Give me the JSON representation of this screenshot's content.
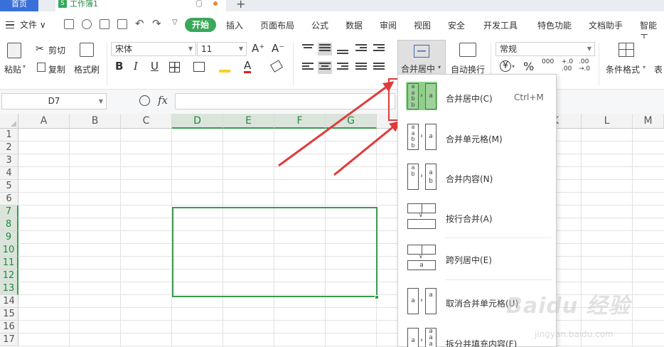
{
  "tabs": {
    "home": "首页",
    "doc_icon": "S",
    "doc_name": "工作簿1",
    "add": "+"
  },
  "menu": {
    "file": "文件 ∨",
    "start": "开始",
    "items": [
      "插入",
      "页面布局",
      "公式",
      "数据",
      "审阅",
      "视图",
      "安全",
      "开发工具",
      "特色功能",
      "文档助手",
      "智能工"
    ]
  },
  "ribbon": {
    "paste": "粘贴",
    "cut": "剪切",
    "copy": "复制",
    "format_painter": "格式刷",
    "font_name": "宋体",
    "font_size": "11",
    "grow_font": "A⁺",
    "shrink_font": "A⁻",
    "bold": "B",
    "italic": "I",
    "underline": "U",
    "merge_center": "合并居中",
    "wrap_text": "自动换行",
    "number_format": "常规",
    "currency": "¥",
    "percent": "%",
    "thousands": "000",
    "inc_decimal": "+.0\n.00",
    "dec_decimal": ".00\n→.0",
    "conditional_format": "条件格式",
    "table_style": "表"
  },
  "formula_bar": {
    "cell_ref": "D7",
    "fx": "fx",
    "value": ""
  },
  "grid": {
    "columns": [
      "A",
      "B",
      "C",
      "D",
      "E",
      "F",
      "G",
      "H",
      "I",
      "J",
      "K",
      "L",
      "M"
    ],
    "rows": [
      "1",
      "2",
      "3",
      "4",
      "5",
      "6",
      "7",
      "8",
      "9",
      "10",
      "11",
      "12",
      "13",
      "14",
      "15",
      "16",
      "17"
    ],
    "selected_columns": [
      "D",
      "E",
      "F",
      "G"
    ],
    "selected_rows": [
      "7",
      "8",
      "9",
      "10",
      "11",
      "12",
      "13"
    ],
    "selected_range": "D7:G13"
  },
  "dropdown": {
    "items": [
      {
        "label": "合并居中(C)",
        "shortcut": "Ctrl+M"
      },
      {
        "label": "合并单元格(M)"
      },
      {
        "label": "合并内容(N)"
      },
      {
        "label": "按行合并(A)"
      },
      {
        "label": "跨列居中(E)"
      },
      {
        "label": "取消合并单元格(U)"
      },
      {
        "label": "拆分并填充内容(F)"
      }
    ]
  },
  "watermark": {
    "main": "Baidu 经验",
    "sub": "jingyan.baidu.com"
  },
  "colors": {
    "accent_green": "#3aa85a",
    "highlight_red": "#e03a3a",
    "selection_green": "#3a9a50"
  }
}
